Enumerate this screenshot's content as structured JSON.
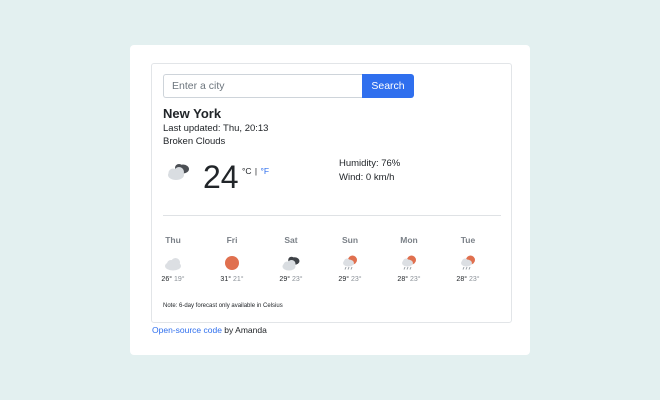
{
  "search": {
    "placeholder": "Enter a city",
    "button_label": "Search"
  },
  "current": {
    "city": "New York",
    "last_updated": "Last updated: Thu, 20:13",
    "description": "Broken Clouds",
    "temperature": "24",
    "unit_c": "°C",
    "unit_separator": "|",
    "unit_f": "°F",
    "humidity": "Humidity: 76%",
    "wind": "Wind: 0 km/h",
    "icon": "broken-clouds-icon"
  },
  "forecast": [
    {
      "day": "Thu",
      "high": "26°",
      "low": "19°",
      "icon": "cloud-icon"
    },
    {
      "day": "Fri",
      "high": "31°",
      "low": "21°",
      "icon": "sun-icon"
    },
    {
      "day": "Sat",
      "high": "29°",
      "low": "23°",
      "icon": "broken-clouds-icon"
    },
    {
      "day": "Sun",
      "high": "29°",
      "low": "23°",
      "icon": "sun-rain-icon"
    },
    {
      "day": "Mon",
      "high": "28°",
      "low": "23°",
      "icon": "sun-rain-icon"
    },
    {
      "day": "Tue",
      "high": "28°",
      "low": "23°",
      "icon": "sun-rain-icon"
    }
  ],
  "note": "Note: 6-day forecast only available in Celsius",
  "footer": {
    "link_text": "Open-source code",
    "suffix": " by Amanda"
  },
  "colors": {
    "background": "#e3f0f0",
    "accent": "#2f6fee",
    "sun": "#e0704f"
  }
}
